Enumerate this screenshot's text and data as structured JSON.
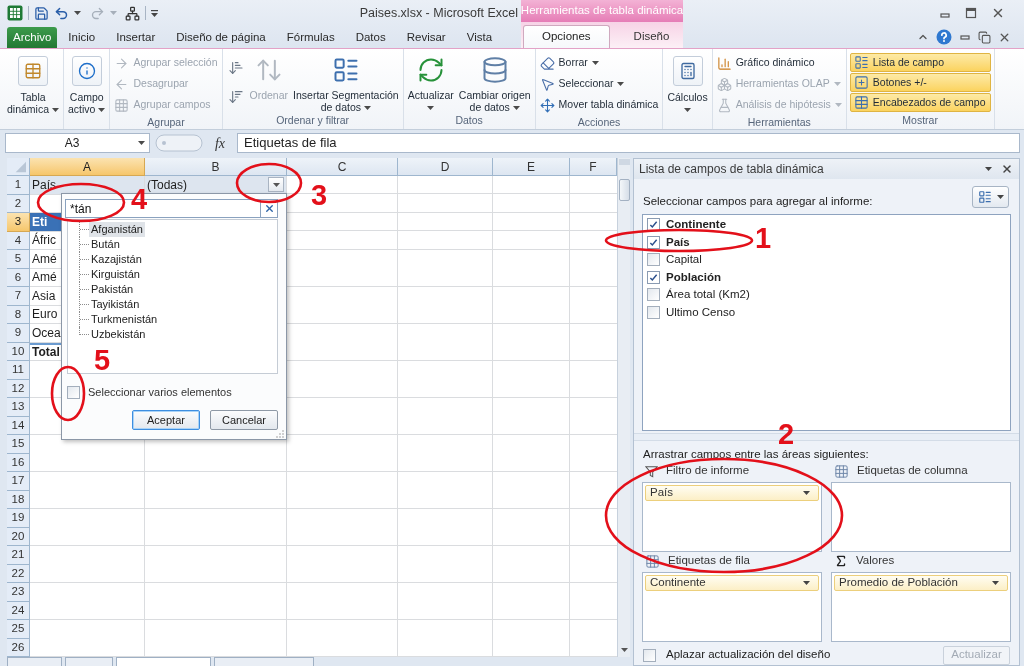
{
  "window": {
    "title": "Paises.xlsx - Microsoft Excel",
    "contextual_group": "Herramientas de tabla dinámica"
  },
  "ribbon_tabs": [
    {
      "label": "Archivo",
      "kind": "backstage",
      "selected": false
    },
    {
      "label": "Inicio",
      "kind": "standard",
      "selected": false
    },
    {
      "label": "Insertar",
      "kind": "standard",
      "selected": false
    },
    {
      "label": "Diseño de página",
      "kind": "standard",
      "selected": false
    },
    {
      "label": "Fórmulas",
      "kind": "standard",
      "selected": false
    },
    {
      "label": "Datos",
      "kind": "standard",
      "selected": false
    },
    {
      "label": "Revisar",
      "kind": "standard",
      "selected": false
    },
    {
      "label": "Vista",
      "kind": "standard",
      "selected": false
    },
    {
      "label": "Opciones",
      "kind": "contextual",
      "selected": true
    },
    {
      "label": "Diseño",
      "kind": "contextual",
      "selected": false
    }
  ],
  "ribbon_groups": [
    {
      "items": [
        {
          "kind": "large",
          "label": "Tabla\ndinámica",
          "dropdown": true,
          "disabled": false
        }
      ]
    },
    {
      "items": [
        {
          "kind": "large",
          "label": "Campo\nactivo",
          "dropdown": true,
          "disabled": false
        }
      ]
    },
    {
      "label": "Agrupar",
      "items": [
        {
          "kind": "small",
          "label": "Agrupar selección",
          "disabled": true
        },
        {
          "kind": "small",
          "label": "Desagrupar",
          "disabled": true
        },
        {
          "kind": "small",
          "label": "Agrupar campos",
          "disabled": true
        }
      ]
    },
    {
      "label": "Ordenar y filtrar",
      "items": [
        {
          "kind": "icon",
          "disabled": false
        },
        {
          "kind": "icon",
          "disabled": false
        },
        {
          "kind": "large",
          "label": "Ordenar",
          "disabled": true
        },
        {
          "kind": "large",
          "label": "Insertar Segmentación\nde datos",
          "dropdown": true,
          "disabled": false
        }
      ]
    },
    {
      "label": "Datos",
      "items": [
        {
          "kind": "large",
          "label": "Actualizar",
          "dropdown": true,
          "disabled": false
        },
        {
          "kind": "large",
          "label": "Cambiar origen\nde datos",
          "dropdown": true,
          "disabled": false
        }
      ]
    },
    {
      "label": "Acciones",
      "items": [
        {
          "kind": "small",
          "label": "Borrar",
          "dropdown": true,
          "disabled": false
        },
        {
          "kind": "small",
          "label": "Seleccionar",
          "dropdown": true,
          "disabled": false
        },
        {
          "kind": "small",
          "label": "Mover tabla dinámica",
          "disabled": false
        }
      ]
    },
    {
      "items": [
        {
          "kind": "large",
          "label": "Cálculos",
          "dropdown": true,
          "disabled": false
        }
      ]
    },
    {
      "label": "Herramientas",
      "items": [
        {
          "kind": "small",
          "label": "Gráfico dinámico",
          "disabled": false
        },
        {
          "kind": "small",
          "label": "Herramientas OLAP",
          "dropdown": true,
          "disabled": true
        },
        {
          "kind": "small",
          "label": "Análisis de hipótesis",
          "dropdown": true,
          "disabled": true
        }
      ]
    },
    {
      "label": "Mostrar",
      "items": [
        {
          "kind": "toggle",
          "label": "Lista de campo",
          "on": true,
          "disabled": false
        },
        {
          "kind": "toggle",
          "label": "Botones +/-",
          "on": true,
          "disabled": false
        },
        {
          "kind": "toggle",
          "label": "Encabezados de campo",
          "on": true,
          "disabled": false
        }
      ]
    }
  ],
  "formula_bar": {
    "name_box": "A3",
    "function_label": "fx",
    "formula": "Etiquetas de fila"
  },
  "sheet": {
    "columns": [
      {
        "label": "A",
        "selected": true
      },
      {
        "label": "B",
        "selected": false
      },
      {
        "label": "C",
        "selected": false
      },
      {
        "label": "D",
        "selected": false
      },
      {
        "label": "E",
        "selected": false
      },
      {
        "label": "F",
        "selected": false
      }
    ],
    "rows": [
      {
        "label": "1",
        "selected": false,
        "cells": [
          {
            "text": "País",
            "kind": "filter_field"
          },
          {
            "text": "(Todas)",
            "kind": "filter_value"
          }
        ]
      },
      {
        "label": "2",
        "selected": false
      },
      {
        "label": "3",
        "selected": true,
        "cells": [
          {
            "text": "Eti",
            "kind": "header"
          }
        ]
      },
      {
        "label": "4",
        "selected": false,
        "cells": [
          {
            "text": "Áfric",
            "kind": "item"
          }
        ]
      },
      {
        "label": "5",
        "selected": false,
        "cells": [
          {
            "text": "Amé",
            "kind": "item"
          }
        ]
      },
      {
        "label": "6",
        "selected": false,
        "cells": [
          {
            "text": "Amé",
            "kind": "item"
          }
        ]
      },
      {
        "label": "7",
        "selected": false,
        "cells": [
          {
            "text": "Asia",
            "kind": "item"
          }
        ]
      },
      {
        "label": "8",
        "selected": false,
        "cells": [
          {
            "text": "Euro",
            "kind": "item"
          }
        ]
      },
      {
        "label": "9",
        "selected": false,
        "cells": [
          {
            "text": "Ocea",
            "kind": "item"
          }
        ]
      },
      {
        "label": "10",
        "selected": false,
        "cells": [
          {
            "text": "Total",
            "kind": "total"
          }
        ]
      },
      {
        "label": "11",
        "selected": false
      },
      {
        "label": "12",
        "selected": false
      },
      {
        "label": "13",
        "selected": false
      },
      {
        "label": "14",
        "selected": false
      },
      {
        "label": "15",
        "selected": false
      },
      {
        "label": "16",
        "selected": false
      },
      {
        "label": "17",
        "selected": false
      },
      {
        "label": "18",
        "selected": false
      },
      {
        "label": "19",
        "selected": false
      },
      {
        "label": "20",
        "selected": false
      },
      {
        "label": "21",
        "selected": false
      },
      {
        "label": "22",
        "selected": false
      },
      {
        "label": "23",
        "selected": false
      },
      {
        "label": "24",
        "selected": false
      },
      {
        "label": "25",
        "selected": false
      },
      {
        "label": "26",
        "selected": false
      }
    ],
    "sheet_tabs": [
      {
        "selected": false
      },
      {
        "selected": false
      },
      {
        "selected": true
      },
      {
        "selected": false
      }
    ]
  },
  "filter_popup": {
    "search": {
      "value": "*tán"
    },
    "items": [
      {
        "label": "Afganistán",
        "selected": true
      },
      {
        "label": "Bután",
        "selected": false
      },
      {
        "label": "Kazajistán",
        "selected": false
      },
      {
        "label": "Kirguistán",
        "selected": false
      },
      {
        "label": "Pakistán",
        "selected": false
      },
      {
        "label": "Tayikistán",
        "selected": false
      },
      {
        "label": "Turkmenistán",
        "selected": false
      },
      {
        "label": "Uzbekistán",
        "selected": false
      }
    ],
    "multi_select": {
      "label": "Seleccionar varios elementos",
      "checked": false
    },
    "buttons": [
      {
        "label": "Aceptar",
        "default": true
      },
      {
        "label": "Cancelar",
        "default": false
      }
    ]
  },
  "field_list": {
    "title": "Lista de campos de tabla dinámica",
    "prompt": "Seleccionar campos para agregar al informe:",
    "fields": [
      {
        "label": "Continente",
        "checked": true
      },
      {
        "label": "País",
        "checked": true
      },
      {
        "label": "Capital",
        "checked": false
      },
      {
        "label": "Población",
        "checked": true
      },
      {
        "label": "Área total (Km2)",
        "checked": false
      },
      {
        "label": "Ultimo Censo",
        "checked": false
      }
    ],
    "areas_prompt": "Arrastrar campos entre las áreas siguientes:",
    "areas": [
      {
        "kind": "filter",
        "label": "Filtro de informe",
        "items": [
          {
            "label": "País"
          }
        ]
      },
      {
        "kind": "columns",
        "label": "Etiquetas de columna"
      },
      {
        "kind": "rows",
        "label": "Etiquetas de fila",
        "items": [
          {
            "label": "Continente"
          }
        ]
      },
      {
        "kind": "values",
        "label": "Valores",
        "items": [
          {
            "label": "Promedio de Población"
          }
        ]
      }
    ],
    "defer_update": {
      "label": "Aplazar actualización del diseño",
      "checked": false
    },
    "update_button": {
      "label": "Actualizar",
      "disabled": true
    }
  },
  "annotations": [
    {
      "label": "1"
    },
    {
      "label": "2"
    },
    {
      "label": "3"
    },
    {
      "label": "4"
    },
    {
      "label": "5"
    }
  ]
}
